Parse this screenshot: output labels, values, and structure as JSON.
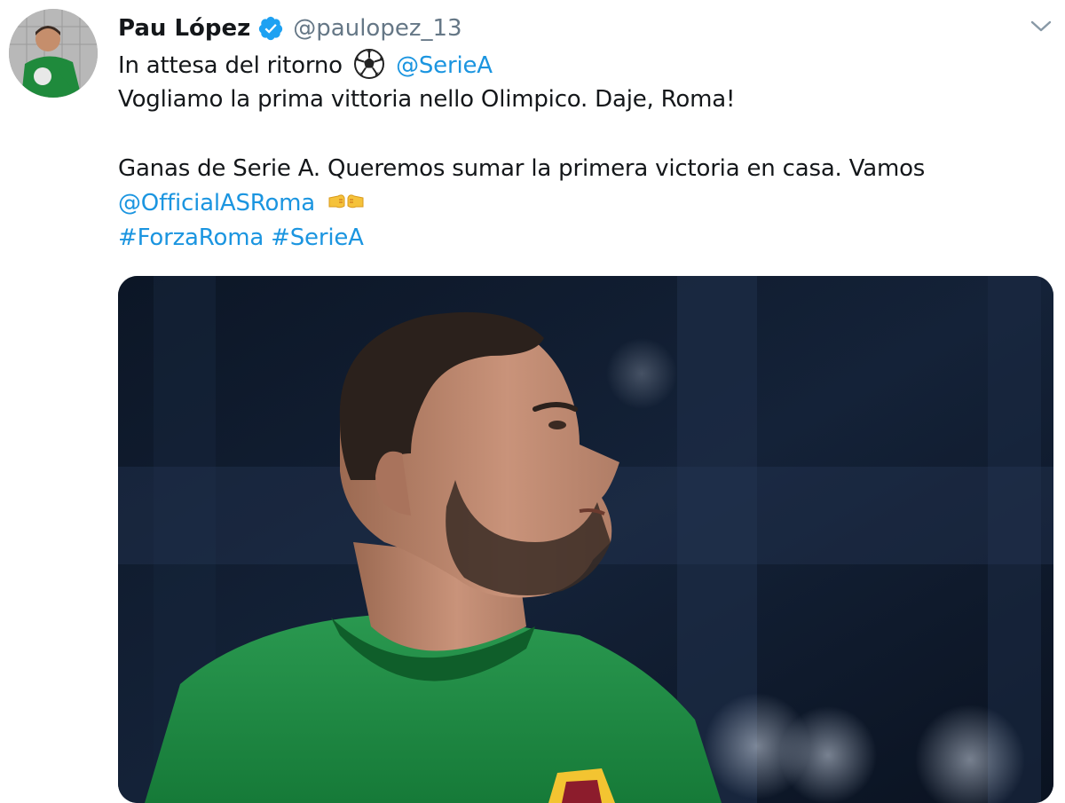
{
  "tweet": {
    "author": {
      "name": "Pau López",
      "handle": "@paulopez_13",
      "verified": true,
      "avatar_icon": "goalkeeper-avatar"
    },
    "lines": {
      "line1_text": "In attesa del ritorno",
      "line1_emoji": "soccer-ball-icon",
      "line1_mention": "@SerieA",
      "line2": "Vogliamo la prima vittoria nello Olimpico. Daje, Roma!",
      "line3": "Ganas de Serie A. Queremos sumar la primera victoria en casa. Vamos",
      "line4_mention": "@OfficialASRoma",
      "line4_emoji": "fist-bump-icon",
      "hashtag1": "#ForzaRoma",
      "hashtag2": "#SerieA"
    },
    "menu_icon": "chevron-down-icon",
    "media": {
      "kind": "photo",
      "subject": "goalkeeper-photo"
    }
  },
  "colors": {
    "link": "#1b95e0",
    "handle": "#657786",
    "verified": "#1da1f2",
    "text": "#14171a"
  }
}
